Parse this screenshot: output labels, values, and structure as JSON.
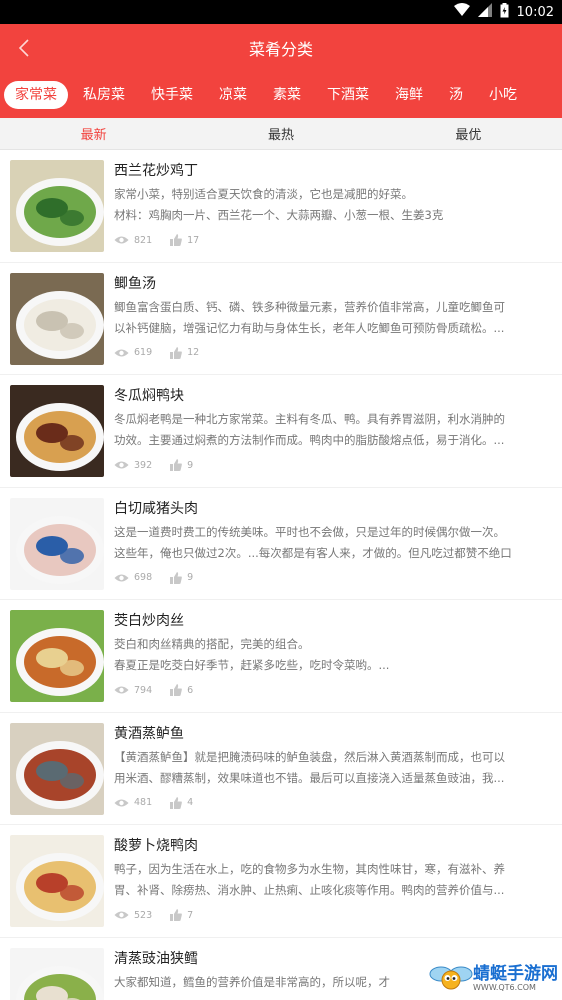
{
  "status": {
    "time": "10:02"
  },
  "header": {
    "title": "菜肴分类"
  },
  "categories": [
    "家常菜",
    "私房菜",
    "快手菜",
    "凉菜",
    "素菜",
    "下酒菜",
    "海鲜",
    "汤",
    "小吃"
  ],
  "active_category": "家常菜",
  "sorts": [
    "最新",
    "最热",
    "最优"
  ],
  "active_sort": "最新",
  "recipes": [
    {
      "title": "西兰花炒鸡丁",
      "desc1": "家常小菜，特别适合夏天饮食的清淡，它也是减肥的好菜。",
      "desc2": "材料：鸡胸肉一片、西兰花一个、大蒜两瓣、小葱一根、生姜3克",
      "views": "821",
      "likes": "17",
      "colors": [
        "#2f6e2a",
        "#6fa84a",
        "#d9d2b6"
      ]
    },
    {
      "title": "鲫鱼汤",
      "desc1": "鲫鱼富含蛋白质、钙、磷、铁多种微量元素，营养价值非常高，儿童吃鲫鱼可",
      "desc2": "以补钙健脑，增强记忆力有助与身体生长，老年人吃鲫鱼可预防骨质疏松。...",
      "views": "619",
      "likes": "12",
      "colors": [
        "#c9c2b2",
        "#f0ece2",
        "#7a6a52"
      ]
    },
    {
      "title": "冬瓜焖鸭块",
      "desc1": "冬瓜焖老鸭是一种北方家常菜。主料有冬瓜、鸭。具有养胃滋阴，利水消肿的",
      "desc2": "功效。主要通过焖煮的方法制作而成。鸭肉中的脂肪酸熔点低，易于消化。...",
      "views": "392",
      "likes": "9",
      "colors": [
        "#6a2c1a",
        "#d8a050",
        "#3a2a20"
      ]
    },
    {
      "title": "白切咸猪头肉",
      "desc1": "这是一道费时费工的传统美味。平时也不会做，只是过年的时候偶尔做一次。",
      "desc2": "这些年，俺也只做过2次。...每次都是有客人来，才做的。但凡吃过都赞不绝口",
      "views": "698",
      "likes": "9",
      "colors": [
        "#2a5ea8",
        "#e8c8c0",
        "#f5f5f5"
      ]
    },
    {
      "title": "茭白炒肉丝",
      "desc1": "茭白和肉丝精典的搭配，完美的组合。",
      "desc2": "春夏正是吃茭白好季节，赶紧多吃些，吃时令菜哟。...",
      "views": "794",
      "likes": "6",
      "colors": [
        "#e8d090",
        "#c86a2a",
        "#7ab04a"
      ]
    },
    {
      "title": "黄酒蒸鲈鱼",
      "desc1": "【黄酒蒸鲈鱼】就是把腌渍码味的鲈鱼装盘，然后淋入黄酒蒸制而成，也可以",
      "desc2": "用米酒、醪糟蒸制，效果味道也不错。最后可以直接浇入适量蒸鱼豉油，我...",
      "views": "481",
      "likes": "4",
      "colors": [
        "#5a6a72",
        "#a8442a",
        "#d8d0c0"
      ]
    },
    {
      "title": "酸萝卜烧鸭肉",
      "desc1": "鸭子，因为生活在水上，吃的食物多为水生物，其肉性味甘，寒，有滋补、养",
      "desc2": "胃、补肾、除痨热、消水肿、止热痢、止咳化痰等作用。鸭肉的营养价值与...",
      "views": "523",
      "likes": "7",
      "colors": [
        "#b8402a",
        "#e8c070",
        "#f2eee4"
      ]
    },
    {
      "title": "清蒸豉油狭鳕",
      "desc1": "大家都知道，鳕鱼的营养价值是非常高的，所以呢，才",
      "desc2": "",
      "views": "",
      "likes": "",
      "colors": [
        "#e8e0d0",
        "#8ab04a",
        "#f5f5f5"
      ]
    }
  ],
  "watermark": {
    "name": "蜻蜓手游网",
    "url": "WWW.QT6.COM"
  }
}
